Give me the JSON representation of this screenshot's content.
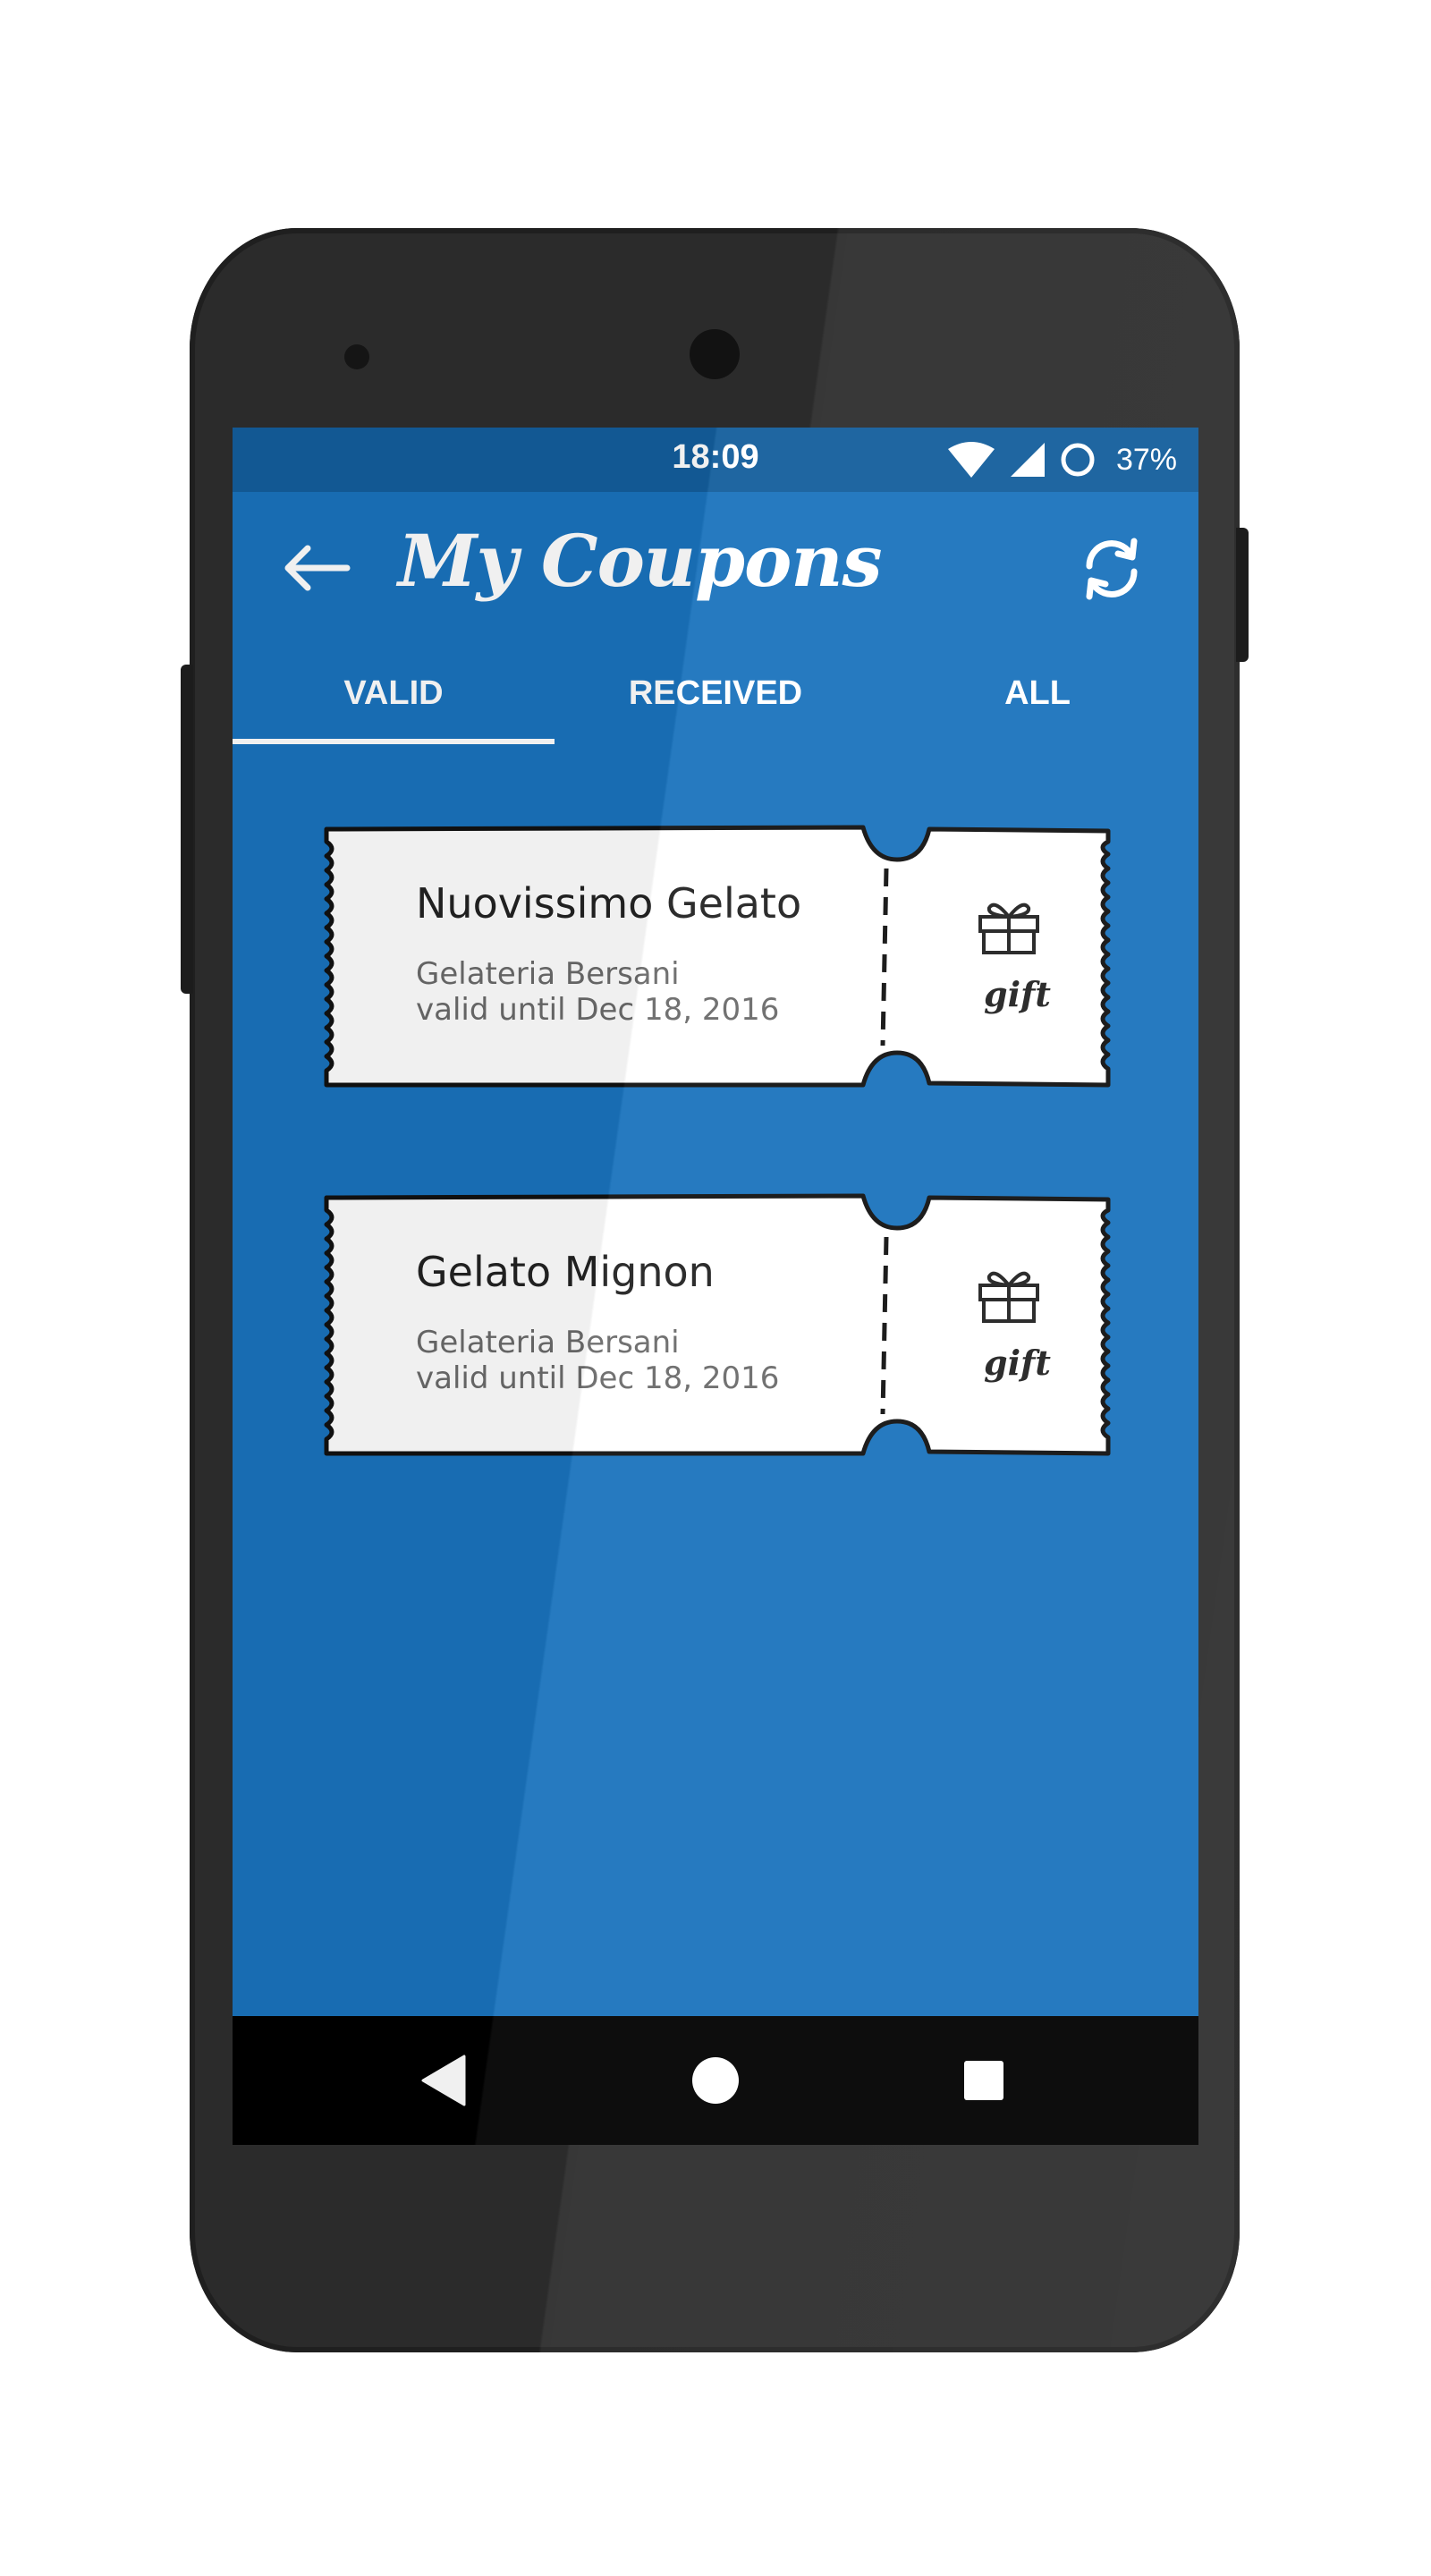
{
  "status_bar": {
    "time": "18:09",
    "battery": "37%",
    "icons": [
      "wifi-icon",
      "signal-icon",
      "sync-circle-icon"
    ]
  },
  "app_bar": {
    "title": "My Coupons",
    "back_icon": "arrow-left-icon",
    "refresh_icon": "refresh-icon"
  },
  "tabs": [
    {
      "label": "VALID",
      "selected": true
    },
    {
      "label": "RECEIVED",
      "selected": false
    },
    {
      "label": "ALL",
      "selected": false
    }
  ],
  "coupons": [
    {
      "name": "Nuovissimo Gelato",
      "shop": "Gelateria Bersani",
      "valid": "valid until Dec 18, 2016",
      "badge_icon": "gift-icon",
      "badge_label": "gift"
    },
    {
      "name": "Gelato Mignon",
      "shop": "Gelateria Bersani",
      "valid": "valid until Dec 18, 2016",
      "badge_icon": "gift-icon",
      "badge_label": "gift"
    }
  ],
  "nav_bar": {
    "buttons": [
      "back-triangle-icon",
      "home-circle-icon",
      "recents-square-icon"
    ]
  },
  "colors": {
    "primary": "#1a73bd",
    "status_bar": "#135e9c",
    "phone_body": "#2b2b2b",
    "ticket": "#ffffff",
    "text_primary": "#222222",
    "text_secondary": "#6a6a6a"
  }
}
